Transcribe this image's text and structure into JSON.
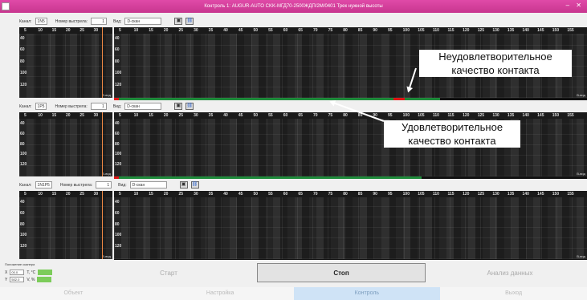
{
  "window": {
    "title": "Контроль 1: AUGUR-AUTO CKK-МГД70-2500ЖДП/2М/0401 Трек нужной высоты"
  },
  "panels": [
    {
      "channel_label": "Канал:",
      "channel_value": "1N5",
      "repeat_label": "Номер выстрела:",
      "repeat_value": "1",
      "view_label": "Вид:",
      "view_value": "D-скан"
    },
    {
      "channel_label": "Канал:",
      "channel_value": "1P5",
      "repeat_label": "Номер выстрела:",
      "repeat_value": "1",
      "view_label": "Вид:",
      "view_value": "D-скан"
    },
    {
      "channel_label": "Канал:",
      "channel_value": "1N1P5",
      "repeat_label": "Номер выстрела:",
      "repeat_value": "1",
      "view_label": "Вид:",
      "view_value": "D-скан"
    }
  ],
  "left_ticks": [
    "5",
    "10",
    "15",
    "20",
    "25",
    "30"
  ],
  "right_ticks": [
    "5",
    "10",
    "15",
    "20",
    "25",
    "30",
    "35",
    "40",
    "45",
    "50",
    "55",
    "60",
    "65",
    "70",
    "75",
    "80",
    "85",
    "90",
    "95",
    "100",
    "105",
    "110",
    "115",
    "120",
    "125",
    "130",
    "135",
    "140",
    "145",
    "150",
    "155"
  ],
  "y_ticks": [
    "40",
    "60",
    "80",
    "100",
    "120"
  ],
  "scan_corner_label": "В-вид",
  "quality_bars": [
    {
      "green_fraction": 0.69,
      "bad_from": 0.59,
      "bad_to": 0.615,
      "left_bad": true
    },
    {
      "green_fraction": 0.65,
      "left_bad": true
    },
    {
      "green_fraction": 0.0,
      "left_bad": false
    }
  ],
  "annotations": {
    "bad": "Неудовлетворительное качество контакта",
    "good": "Удовлетворительное качество контакта"
  },
  "scanner": {
    "title": "Положение сканера",
    "x_label": "X",
    "x_value": "00.0",
    "t_label": "T, °C",
    "y_label": "Y",
    "y_value": "502.0",
    "v_label": "V, %"
  },
  "actions": {
    "start": "Старт",
    "stop": "Стоп",
    "analysis": "Анализ данных"
  },
  "tabs": [
    "Объект",
    "Настройка",
    "Контроль",
    "Выход"
  ],
  "active_tab_index": 2,
  "colors": {
    "good": "#1e8a3a",
    "bad": "#e01515",
    "titlebar": "#d23f9c"
  }
}
